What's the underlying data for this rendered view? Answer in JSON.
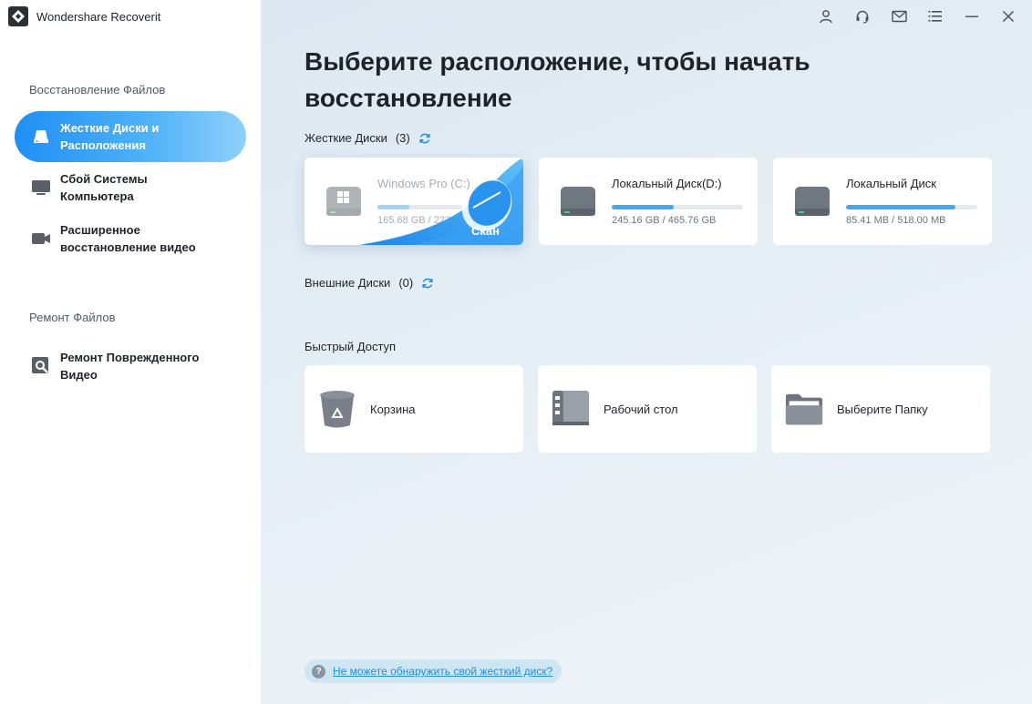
{
  "app": {
    "name": "Wondershare Recoverit"
  },
  "sidebar": {
    "section_recovery": "Восстановление Файлов",
    "items": [
      {
        "label": "Жесткие Диски и\nРасположения",
        "icon": "drive-location-icon",
        "active": true
      },
      {
        "label": "Сбой Системы\nКомпьютера",
        "icon": "monitor-icon",
        "active": false
      },
      {
        "label": "Расширенное\nвосстановление видео",
        "icon": "video-camera-icon",
        "active": false
      }
    ],
    "section_repair": "Ремонт Файлов",
    "repair_items": [
      {
        "label": "Ремонт Поврежденного\nВидео",
        "icon": "video-repair-icon"
      }
    ]
  },
  "titlebar": {
    "icons": [
      "account-icon",
      "support-headset-icon",
      "mail-icon",
      "menu-icon",
      "minimize-icon",
      "close-icon"
    ]
  },
  "main": {
    "title": "Выберите расположение, чтобы начать восстановление",
    "hard_disks": {
      "label": "Жесткие Диски",
      "count": "(3)",
      "disks": [
        {
          "name": "Windows Pro (C:)",
          "size": "165.68 GB / 222.8",
          "fill": 0.24,
          "selected": true,
          "scan_label": "Скан"
        },
        {
          "name": "Локальный Диск(D:)",
          "size": "245.16 GB / 465.76 GB",
          "fill": 0.47,
          "selected": false
        },
        {
          "name": "Локальный Диск",
          "size": "85.41 MB / 518.00 MB",
          "fill": 0.83,
          "selected": false
        }
      ]
    },
    "external_disks": {
      "label": "Внешние Диски",
      "count": "(0)"
    },
    "quick_access": {
      "label": "Быстрый Доступ",
      "items": [
        {
          "label": "Корзина",
          "icon": "recycle-bin-icon"
        },
        {
          "label": "Рабочий стол",
          "icon": "desktop-icon"
        },
        {
          "label": "Выберите Папку",
          "icon": "folder-icon"
        }
      ]
    },
    "help_link": "Не можете обнаружить свой жесткий диск?"
  },
  "colors": {
    "accent": "#1f8ff5",
    "bar": "#3fa9f5",
    "link": "#1e8ee6"
  }
}
